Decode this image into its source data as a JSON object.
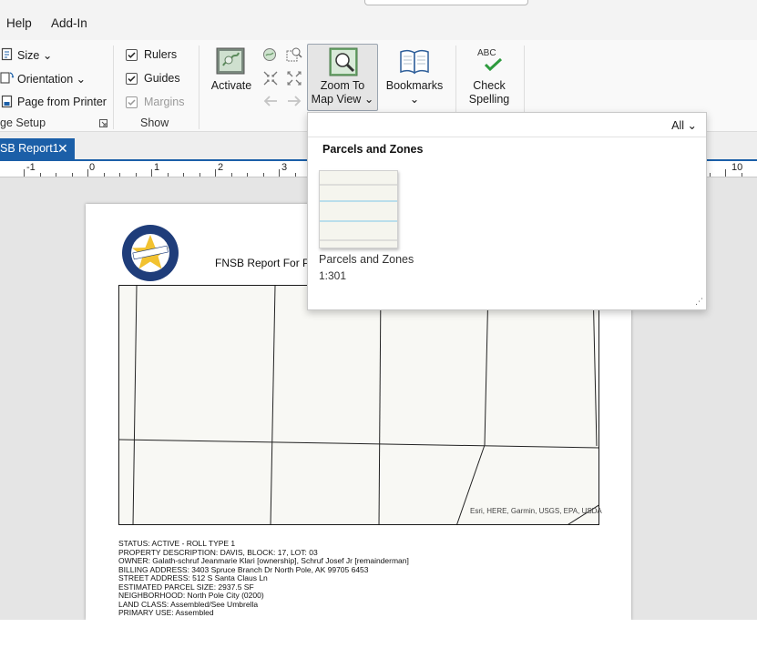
{
  "menu": {
    "help": "Help",
    "add_in": "Add-In"
  },
  "ribbon": {
    "page_setup": {
      "size": "Size",
      "orientation": "Orientation",
      "page_from_printer": "Page from Printer",
      "group_label": "ge Setup"
    },
    "show": {
      "rulers": "Rulers",
      "guides": "Guides",
      "margins": "Margins",
      "group_label": "Show"
    },
    "activate": "Activate",
    "zoom_to_map_view": {
      "line1": "Zoom To",
      "line2": "Map View"
    },
    "bookmarks": "Bookmarks",
    "check_spelling": {
      "line1": "Check",
      "line2": "Spelling",
      "icon_text": "ABC"
    }
  },
  "doc_tab": {
    "label": "SB Report1"
  },
  "ruler": {
    "labels": [
      "-1",
      "0",
      "1",
      "2",
      "3",
      "10"
    ]
  },
  "layout": {
    "report_title": "FNSB Report For P",
    "logo": {
      "top_text": "FAIRBANKS",
      "bottom_text": "NORTH STAR BOROUGH",
      "ribbon_text": "January 1, 1964"
    },
    "attribution": "Esri, HERE, Garmin, USGS, EPA, USDA",
    "info_lines": [
      "STATUS: ACTIVE - ROLL TYPE 1",
      "PROPERTY DESCRIPTION: DAVIS, BLOCK: 17, LOT: 03",
      "OWNER: Galath-schruf Jeanmarie Klari [ownership], Schruf Josef Jr [remainderman]",
      "BILLING ADDRESS: 3403 Spruce Branch Dr North Pole, AK 99705 6453",
      "STREET ADDRESS: 512 S Santa Claus Ln",
      "ESTIMATED PARCEL SIZE: 2937.5 SF",
      "NEIGHBORHOOD: North Pole City (0200)",
      "LAND CLASS: Assembled/See Umbrella",
      "PRIMARY USE: Assembled"
    ]
  },
  "bookmark_gallery": {
    "filter": "All",
    "heading": "Parcels and Zones",
    "items": [
      {
        "name": "Parcels and Zones",
        "scale": "1:301"
      }
    ]
  },
  "colors": {
    "accent": "#1b5fa8",
    "check_green": "#2e9b3e"
  }
}
